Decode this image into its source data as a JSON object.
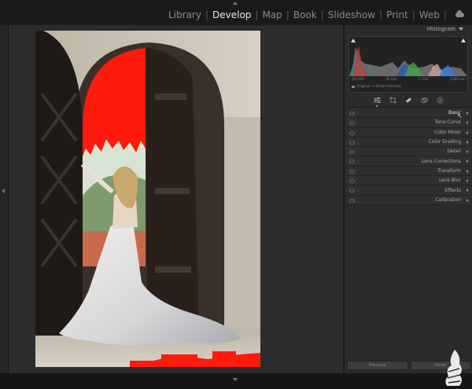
{
  "app": {
    "name": "Lightroom Classic"
  },
  "modules": [
    "Library",
    "Develop",
    "Map",
    "Book",
    "Slideshow",
    "Print",
    "Web"
  ],
  "active_module": "Develop",
  "histogram": {
    "title": "Histogram",
    "exif": [
      "ISO 400",
      "35 mm",
      "f / 2.8",
      "1/200 sec"
    ],
    "preview": "Original + Smart Preview"
  },
  "tools": [
    "sliders-icon",
    "crop-icon",
    "heal-icon",
    "mask-icon",
    "redeye-icon"
  ],
  "panels": [
    {
      "label": "Basic",
      "active": true
    },
    {
      "label": "Tone Curve"
    },
    {
      "label": "Color Mixer"
    },
    {
      "label": "Color Grading"
    },
    {
      "label": "Detail"
    },
    {
      "label": "Lens Corrections"
    },
    {
      "label": "Transform"
    },
    {
      "label": "Lens Blur"
    },
    {
      "label": "Effects"
    },
    {
      "label": "Calibration"
    }
  ],
  "buttons": {
    "previous": "Previous",
    "reset": "Reset"
  },
  "colors": {
    "mask_overlay": "#ff1a0d",
    "panel_bg": "#2b2b2b",
    "chrome_bg": "#1a1a1a"
  }
}
